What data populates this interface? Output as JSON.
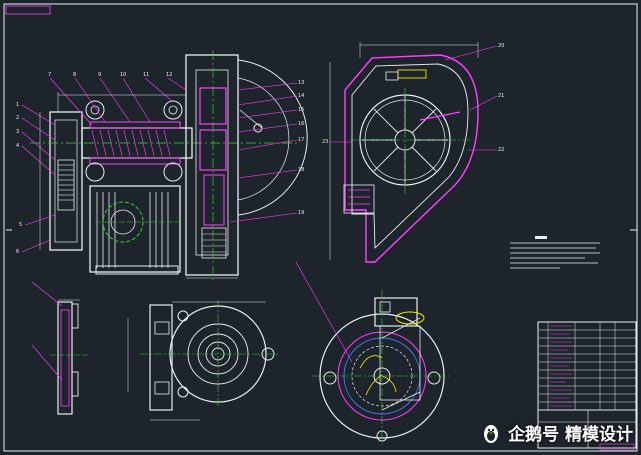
{
  "watermark": {
    "text": "企鹅号 精模设计",
    "icon": "penguin-logo-icon"
  },
  "colors": {
    "background": "#1e242b",
    "line_white": "#e9eef2",
    "line_magenta": "#ff40ff",
    "line_yellow": "#f3e900",
    "line_green": "#33d233",
    "line_blue": "#4a7dff",
    "line_cyan": "#28d8e8",
    "line_red": "#ff3030",
    "annotation_red": "#ff4b4b"
  },
  "drawing": {
    "views": [
      "main-assembly-front-view",
      "blower-housing-side-view",
      "left-section-view",
      "bottom-middle-end-view",
      "bottom-right-impeller-view",
      "technical-requirements-notes",
      "title-block-and-parts-list"
    ]
  }
}
